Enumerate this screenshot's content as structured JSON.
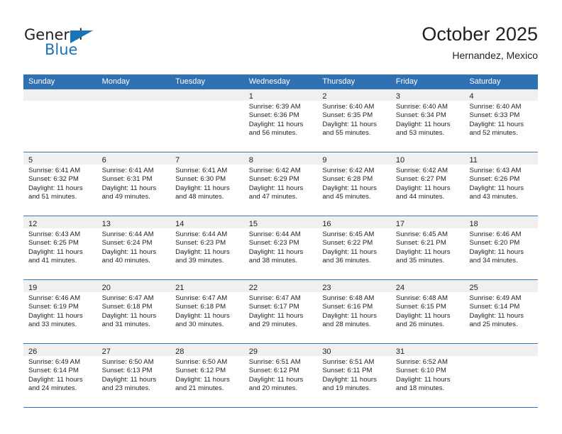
{
  "brand": {
    "name_top": "General",
    "name_bottom": "Blue",
    "triangle_icon": "triangle-icon",
    "accent_color": "#1a73b7"
  },
  "header": {
    "title": "October 2025",
    "subtitle": "Hernandez, Mexico"
  },
  "theme": {
    "header_blue": "#3071b4",
    "row_divider_blue": "#2e71b8",
    "day_band_gray": "#f0f0f0",
    "text_color": "#231f20"
  },
  "weekdays": [
    "Sunday",
    "Monday",
    "Tuesday",
    "Wednesday",
    "Thursday",
    "Friday",
    "Saturday"
  ],
  "weeks": [
    [
      {
        "day": "",
        "lines": []
      },
      {
        "day": "",
        "lines": []
      },
      {
        "day": "",
        "lines": []
      },
      {
        "day": "1",
        "lines": [
          "Sunrise: 6:39 AM",
          "Sunset: 6:36 PM",
          "Daylight: 11 hours",
          "and 56 minutes."
        ]
      },
      {
        "day": "2",
        "lines": [
          "Sunrise: 6:40 AM",
          "Sunset: 6:35 PM",
          "Daylight: 11 hours",
          "and 55 minutes."
        ]
      },
      {
        "day": "3",
        "lines": [
          "Sunrise: 6:40 AM",
          "Sunset: 6:34 PM",
          "Daylight: 11 hours",
          "and 53 minutes."
        ]
      },
      {
        "day": "4",
        "lines": [
          "Sunrise: 6:40 AM",
          "Sunset: 6:33 PM",
          "Daylight: 11 hours",
          "and 52 minutes."
        ]
      }
    ],
    [
      {
        "day": "5",
        "lines": [
          "Sunrise: 6:41 AM",
          "Sunset: 6:32 PM",
          "Daylight: 11 hours",
          "and 51 minutes."
        ]
      },
      {
        "day": "6",
        "lines": [
          "Sunrise: 6:41 AM",
          "Sunset: 6:31 PM",
          "Daylight: 11 hours",
          "and 49 minutes."
        ]
      },
      {
        "day": "7",
        "lines": [
          "Sunrise: 6:41 AM",
          "Sunset: 6:30 PM",
          "Daylight: 11 hours",
          "and 48 minutes."
        ]
      },
      {
        "day": "8",
        "lines": [
          "Sunrise: 6:42 AM",
          "Sunset: 6:29 PM",
          "Daylight: 11 hours",
          "and 47 minutes."
        ]
      },
      {
        "day": "9",
        "lines": [
          "Sunrise: 6:42 AM",
          "Sunset: 6:28 PM",
          "Daylight: 11 hours",
          "and 45 minutes."
        ]
      },
      {
        "day": "10",
        "lines": [
          "Sunrise: 6:42 AM",
          "Sunset: 6:27 PM",
          "Daylight: 11 hours",
          "and 44 minutes."
        ]
      },
      {
        "day": "11",
        "lines": [
          "Sunrise: 6:43 AM",
          "Sunset: 6:26 PM",
          "Daylight: 11 hours",
          "and 43 minutes."
        ]
      }
    ],
    [
      {
        "day": "12",
        "lines": [
          "Sunrise: 6:43 AM",
          "Sunset: 6:25 PM",
          "Daylight: 11 hours",
          "and 41 minutes."
        ]
      },
      {
        "day": "13",
        "lines": [
          "Sunrise: 6:44 AM",
          "Sunset: 6:24 PM",
          "Daylight: 11 hours",
          "and 40 minutes."
        ]
      },
      {
        "day": "14",
        "lines": [
          "Sunrise: 6:44 AM",
          "Sunset: 6:23 PM",
          "Daylight: 11 hours",
          "and 39 minutes."
        ]
      },
      {
        "day": "15",
        "lines": [
          "Sunrise: 6:44 AM",
          "Sunset: 6:23 PM",
          "Daylight: 11 hours",
          "and 38 minutes."
        ]
      },
      {
        "day": "16",
        "lines": [
          "Sunrise: 6:45 AM",
          "Sunset: 6:22 PM",
          "Daylight: 11 hours",
          "and 36 minutes."
        ]
      },
      {
        "day": "17",
        "lines": [
          "Sunrise: 6:45 AM",
          "Sunset: 6:21 PM",
          "Daylight: 11 hours",
          "and 35 minutes."
        ]
      },
      {
        "day": "18",
        "lines": [
          "Sunrise: 6:46 AM",
          "Sunset: 6:20 PM",
          "Daylight: 11 hours",
          "and 34 minutes."
        ]
      }
    ],
    [
      {
        "day": "19",
        "lines": [
          "Sunrise: 6:46 AM",
          "Sunset: 6:19 PM",
          "Daylight: 11 hours",
          "and 33 minutes."
        ]
      },
      {
        "day": "20",
        "lines": [
          "Sunrise: 6:47 AM",
          "Sunset: 6:18 PM",
          "Daylight: 11 hours",
          "and 31 minutes."
        ]
      },
      {
        "day": "21",
        "lines": [
          "Sunrise: 6:47 AM",
          "Sunset: 6:18 PM",
          "Daylight: 11 hours",
          "and 30 minutes."
        ]
      },
      {
        "day": "22",
        "lines": [
          "Sunrise: 6:47 AM",
          "Sunset: 6:17 PM",
          "Daylight: 11 hours",
          "and 29 minutes."
        ]
      },
      {
        "day": "23",
        "lines": [
          "Sunrise: 6:48 AM",
          "Sunset: 6:16 PM",
          "Daylight: 11 hours",
          "and 28 minutes."
        ]
      },
      {
        "day": "24",
        "lines": [
          "Sunrise: 6:48 AM",
          "Sunset: 6:15 PM",
          "Daylight: 11 hours",
          "and 26 minutes."
        ]
      },
      {
        "day": "25",
        "lines": [
          "Sunrise: 6:49 AM",
          "Sunset: 6:14 PM",
          "Daylight: 11 hours",
          "and 25 minutes."
        ]
      }
    ],
    [
      {
        "day": "26",
        "lines": [
          "Sunrise: 6:49 AM",
          "Sunset: 6:14 PM",
          "Daylight: 11 hours",
          "and 24 minutes."
        ]
      },
      {
        "day": "27",
        "lines": [
          "Sunrise: 6:50 AM",
          "Sunset: 6:13 PM",
          "Daylight: 11 hours",
          "and 23 minutes."
        ]
      },
      {
        "day": "28",
        "lines": [
          "Sunrise: 6:50 AM",
          "Sunset: 6:12 PM",
          "Daylight: 11 hours",
          "and 21 minutes."
        ]
      },
      {
        "day": "29",
        "lines": [
          "Sunrise: 6:51 AM",
          "Sunset: 6:12 PM",
          "Daylight: 11 hours",
          "and 20 minutes."
        ]
      },
      {
        "day": "30",
        "lines": [
          "Sunrise: 6:51 AM",
          "Sunset: 6:11 PM",
          "Daylight: 11 hours",
          "and 19 minutes."
        ]
      },
      {
        "day": "31",
        "lines": [
          "Sunrise: 6:52 AM",
          "Sunset: 6:10 PM",
          "Daylight: 11 hours",
          "and 18 minutes."
        ]
      },
      {
        "day": "",
        "lines": []
      }
    ]
  ]
}
